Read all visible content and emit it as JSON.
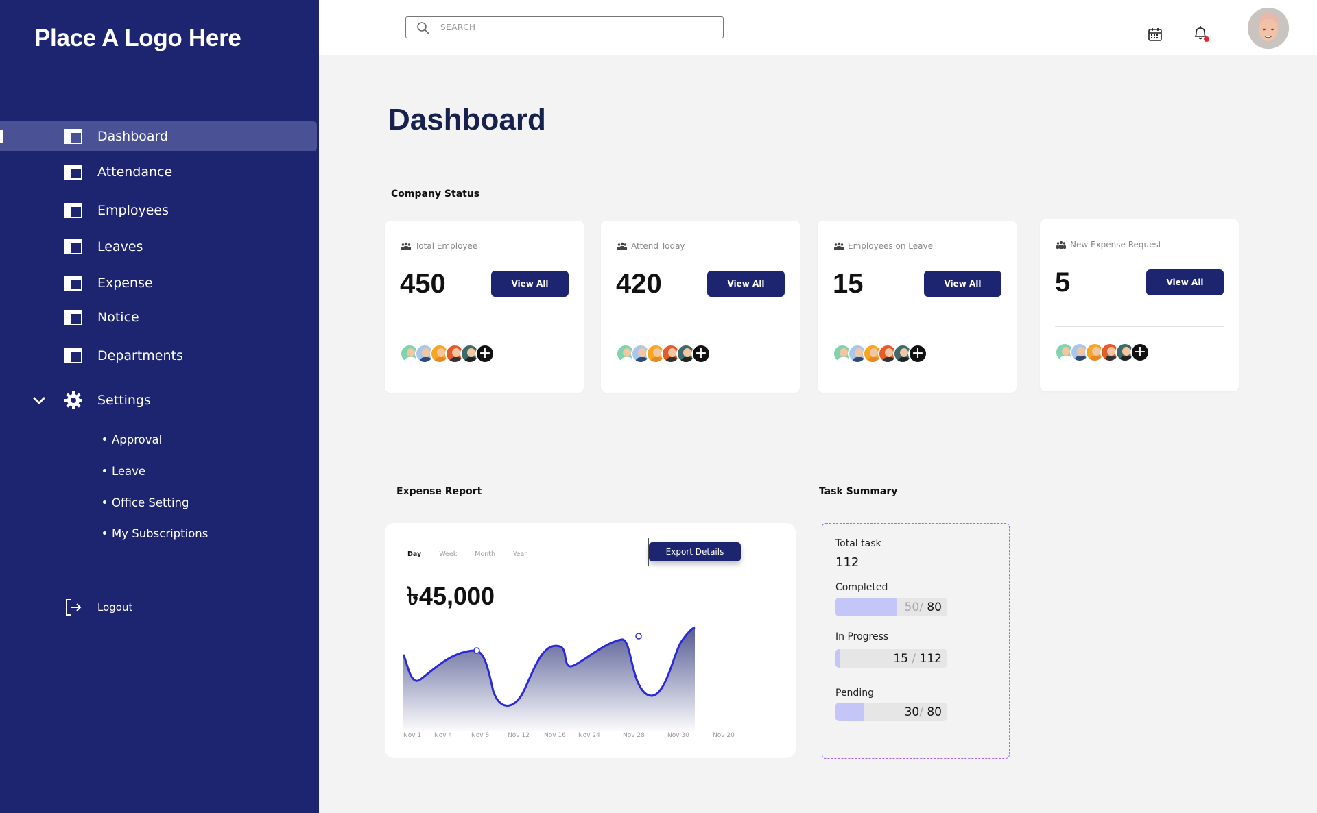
{
  "sidebar": {
    "logo": "Place A Logo Here",
    "items": [
      {
        "label": "Dashboard"
      },
      {
        "label": "Attendance"
      },
      {
        "label": "Employees"
      },
      {
        "label": "Leaves"
      },
      {
        "label": "Expense"
      },
      {
        "label": "Notice"
      },
      {
        "label": "Departments"
      }
    ],
    "settings": {
      "label": "Settings",
      "subitems": [
        "Approval",
        "Leave",
        "Office Setting",
        "My Subscriptions"
      ]
    },
    "logout": "Logout"
  },
  "header": {
    "search_placeholder": "SEARCH",
    "icons": [
      "calendar-icon",
      "bell-icon"
    ],
    "notification_dot_color": "#e8262b"
  },
  "page_title": "Dashboard",
  "company_status": {
    "title": "Company Status",
    "cards": [
      {
        "label": "Total Employee",
        "value": "450",
        "button": "View All"
      },
      {
        "label": "Attend Today",
        "value": "420",
        "button": "View All"
      },
      {
        "label": "Employees on Leave",
        "value": "15",
        "button": "View All"
      },
      {
        "label": "New Expense Request",
        "value": "5",
        "button": "View All"
      }
    ]
  },
  "expense_report": {
    "title": "Expense Report",
    "tabs": [
      "Day",
      "Week",
      "Month",
      "Year"
    ],
    "active_tab": "Day",
    "export_button": "Export Details",
    "total": "৳45,000",
    "chart_data": {
      "type": "area",
      "x_labels": [
        "Nov 1",
        "Nov 4",
        "Nov 8",
        "Nov 12",
        "Nov 16",
        "Nov 24",
        "Nov 28",
        "Nov 30",
        "Nov 20"
      ],
      "title": "",
      "xlabel": "",
      "ylabel": "",
      "line_color": "#2b2bd6",
      "fill_color": "#1d2570"
    }
  },
  "task_summary": {
    "title": "Task Summary",
    "total_label": "Total task",
    "total_value": "112",
    "rows": [
      {
        "label": "Completed",
        "done": "50",
        "sep": "/",
        "total": "80",
        "fraction": 0.55
      },
      {
        "label": "In Progress",
        "done": "15",
        "sep": "/",
        "total": "112",
        "fraction": 0.04
      },
      {
        "label": "Pending",
        "done": "30",
        "sep": "/",
        "total": "80",
        "fraction": 0.25
      }
    ]
  },
  "colors": {
    "sidebar_bg": "#1d2570",
    "active_item_bg": "#4a5295",
    "primary_button": "#1d2570",
    "task_border": "#a565f0",
    "bar_fill": "#c4c6f7"
  }
}
